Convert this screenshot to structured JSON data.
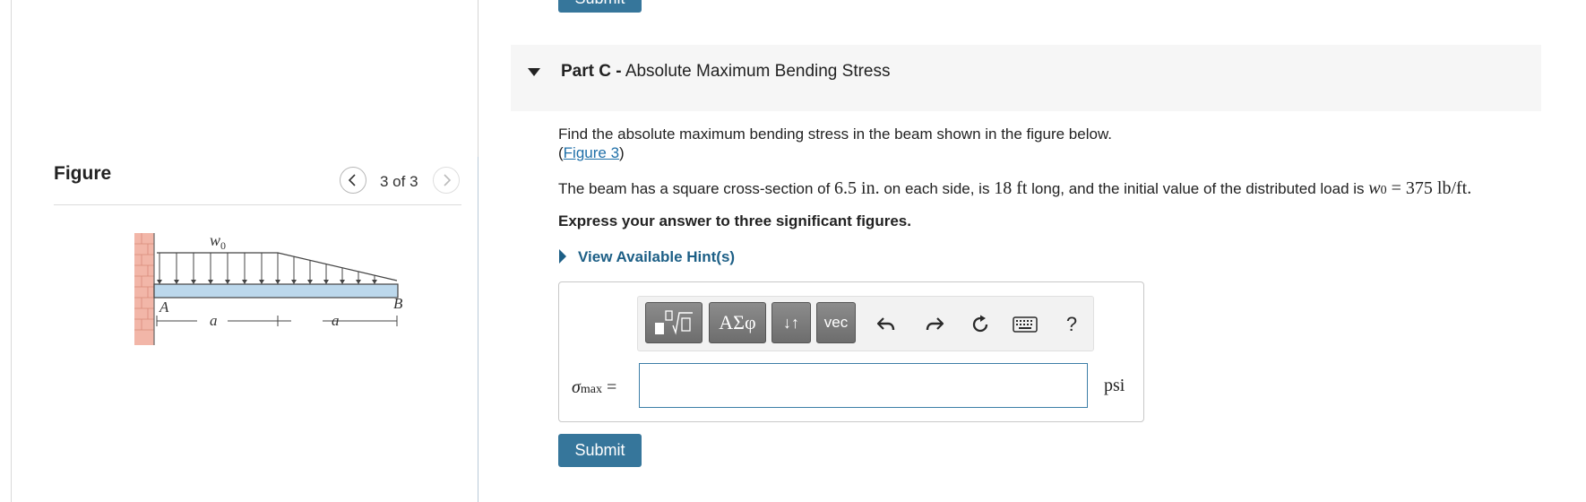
{
  "top_submit_label": "Submit",
  "figure": {
    "title": "Figure",
    "count": "3 of 3",
    "labels": {
      "load": "w",
      "load_sub": "0",
      "a_left": "a",
      "a_right": "a",
      "point_a": "A",
      "point_b": "B"
    }
  },
  "part": {
    "prefix": "Part C -",
    "title": "Absolute Maximum Bending Stress",
    "prompt": "Find the absolute maximum bending stress in the beam shown in the figure below.",
    "figure_link": "Figure 3",
    "given_1": "The beam has a square cross-section of ",
    "side": "6.5 in.",
    "given_2": " on each side, is ",
    "length": "18 ft",
    "given_3": " long, and the initial value of the distributed load is ",
    "w_symbol": "w",
    "w_sub": "0",
    "w_value": " = 375 lb/ft.",
    "instruction": "Express your answer to three significant figures.",
    "hint_label": "View Available Hint(s)"
  },
  "answer": {
    "symbol": "σ",
    "symbol_sub": "max",
    "equals": " =",
    "unit": "psi",
    "value": ""
  },
  "toolbar": {
    "greek_label": "ΑΣφ",
    "updown_label": "↓↑",
    "vec_label": "vec",
    "help_label": "?"
  },
  "submit_label": "Submit"
}
